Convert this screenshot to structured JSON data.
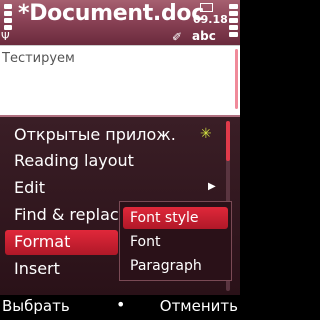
{
  "status": {
    "title": "*Document.doc",
    "clock": "09.18",
    "input_mode": "abc",
    "icons": [
      "signal-icon",
      "antenna-icon",
      "battery-icon",
      "message-icon",
      "pen-icon"
    ]
  },
  "document": {
    "text": "Тестируем"
  },
  "menu": {
    "items": [
      {
        "label": "Открытые прилож."
      },
      {
        "label": "Reading layout"
      },
      {
        "label": "Edit"
      },
      {
        "label": "Find & replace"
      },
      {
        "label": "Format"
      },
      {
        "label": "Insert"
      }
    ],
    "selected": "Format"
  },
  "submenu": {
    "items": [
      {
        "label": "Font style"
      },
      {
        "label": "Font"
      },
      {
        "label": "Paragraph"
      }
    ],
    "selected": "Font style"
  },
  "softkeys": {
    "left": "Выбрать",
    "center": "•",
    "right": "Отменить"
  },
  "colors": {
    "title_bar": "#8a4256",
    "highlight": "#d02030",
    "menu_bg": "#2a1118",
    "scroll_thumb": "#e03a4a"
  }
}
